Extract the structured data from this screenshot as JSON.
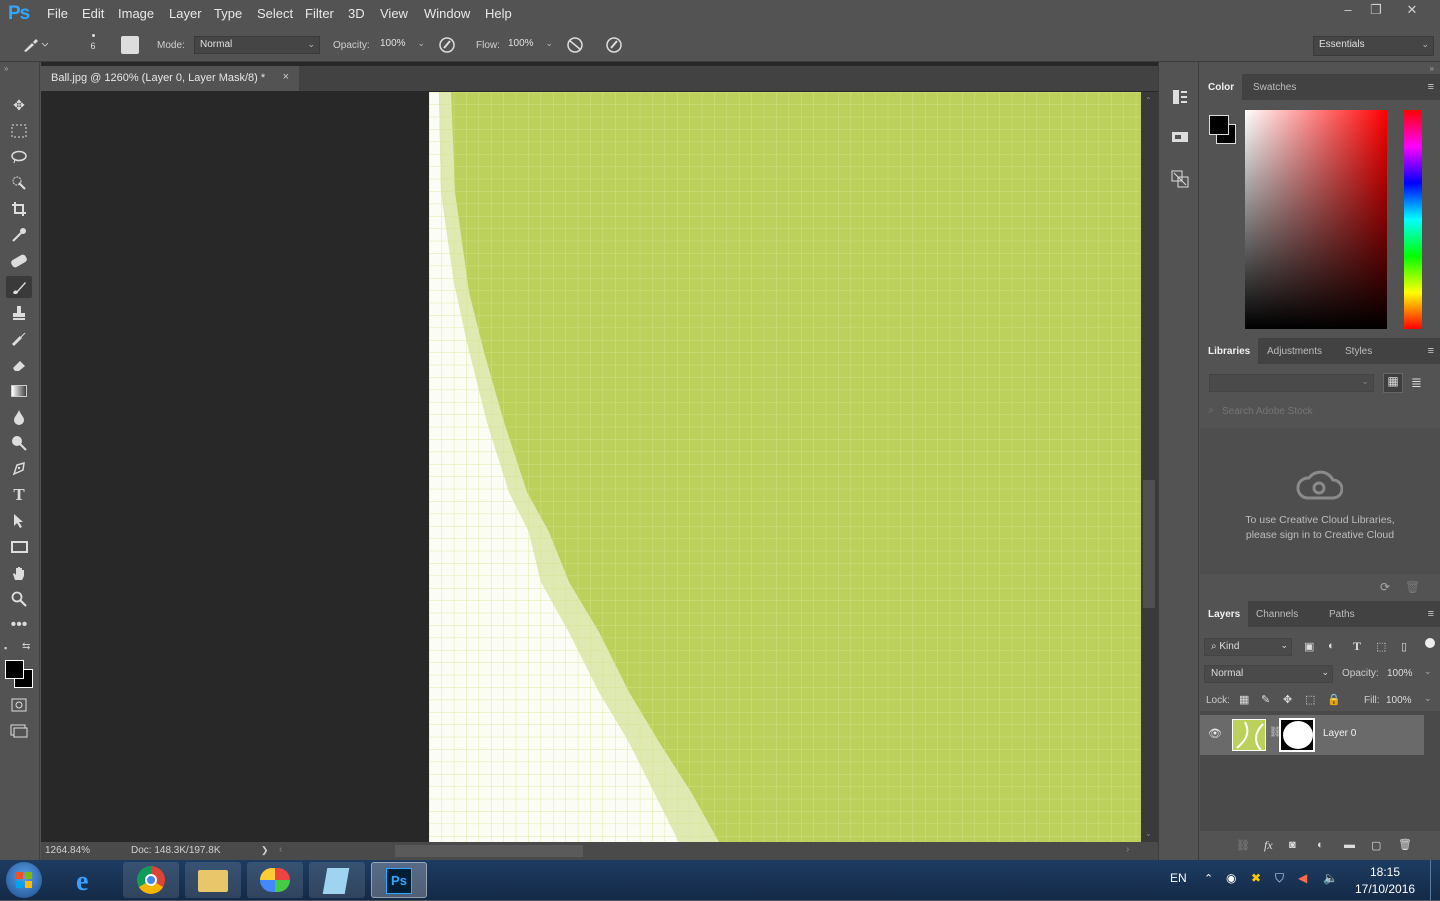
{
  "menubar": {
    "logo": "Ps",
    "items": [
      "File",
      "Edit",
      "Image",
      "Layer",
      "Type",
      "Select",
      "Filter",
      "3D",
      "View",
      "Window",
      "Help"
    ],
    "window_buttons": [
      "–",
      "❐",
      "✕"
    ]
  },
  "options": {
    "brush_size": "6",
    "mode_label": "Mode:",
    "mode_value": "Normal",
    "opacity_label": "Opacity:",
    "opacity_value": "100%",
    "flow_label": "Flow:",
    "flow_value": "100%",
    "workspace": "Essentials"
  },
  "tools": [
    "move-tool",
    "marquee-tool",
    "lasso-tool",
    "quick-select-tool",
    "crop-tool",
    "eyedropper-tool",
    "healing-brush-tool",
    "brush-tool",
    "clone-stamp-tool",
    "history-brush-tool",
    "eraser-tool",
    "gradient-tool",
    "blur-tool",
    "dodge-tool",
    "pen-tool",
    "type-tool",
    "path-select-tool",
    "rectangle-tool",
    "hand-tool",
    "zoom-tool",
    "more-tools"
  ],
  "document": {
    "tab_title": "Ball.jpg @ 1260% (Layer 0, Layer Mask/8) *",
    "close": "×",
    "zoom": "1264.84%",
    "doc_info": "Doc: 148.3K/197.8K",
    "status_arrow": "❯"
  },
  "color_panel": {
    "tabs": [
      "Color",
      "Swatches"
    ],
    "hue_color": "#ff0000"
  },
  "libraries_panel": {
    "tabs": [
      "Libraries",
      "Adjustments",
      "Styles"
    ],
    "search_placeholder": "Search Adobe Stock",
    "message_line1": "To use Creative Cloud Libraries,",
    "message_line2": "please sign in to Creative Cloud"
  },
  "layers_panel": {
    "tabs": [
      "Layers",
      "Channels",
      "Paths"
    ],
    "kind_filter": "Kind",
    "blend_mode": "Normal",
    "opacity_label": "Opacity:",
    "opacity_value": "100%",
    "lock_label": "Lock:",
    "fill_label": "Fill:",
    "fill_value": "100%",
    "layer_name": "Layer 0",
    "bottom_icons": [
      "link-icon",
      "fx-icon",
      "mask-icon",
      "adjustment-icon",
      "folder-icon",
      "new-layer-icon",
      "trash-icon"
    ]
  },
  "taskbar": {
    "apps": [
      "start-button",
      "internet-explorer",
      "chrome",
      "file-explorer",
      "paint-app",
      "notepad-app",
      "photoshop-app"
    ],
    "lang": "EN",
    "time": "18:15",
    "date": "17/10/2016"
  },
  "colors": {
    "canvas_green": "#bcd05c",
    "ps_blue": "#31a8ff",
    "panel_bg": "#535353"
  }
}
